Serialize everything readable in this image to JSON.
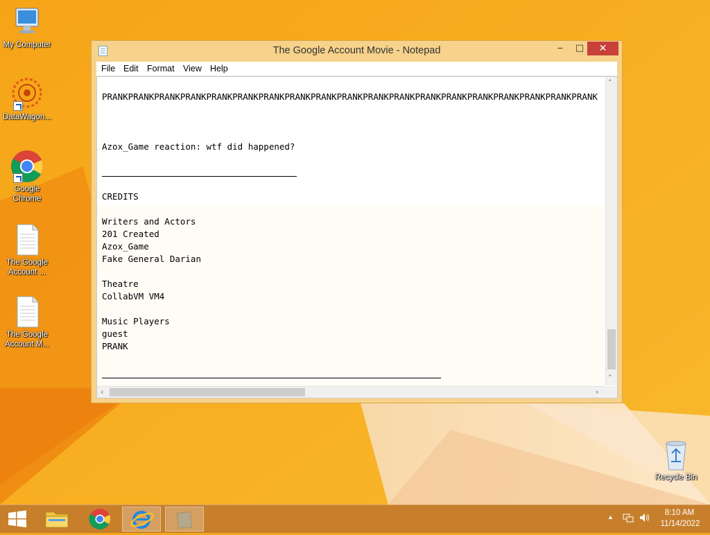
{
  "desktop": {
    "icons": [
      {
        "label": "My Computer",
        "icon": "computer-icon"
      },
      {
        "label": "DataWagon...",
        "icon": "datawagon-icon"
      },
      {
        "label": "Google Chrome",
        "icon": "chrome-icon"
      },
      {
        "label": "The Google Account ...",
        "icon": "text-file-icon"
      },
      {
        "label": "The Google Account M...",
        "icon": "text-file-icon"
      },
      {
        "label": "Recycle Bin",
        "icon": "recycle-bin-icon"
      }
    ],
    "colors": {
      "background": "#f4a81c",
      "accent_light": "#f7d28a"
    }
  },
  "window": {
    "title": "The Google Account Movie - Notepad",
    "controls": {
      "minimize": "‒",
      "maximize": "□",
      "close": "✕"
    },
    "menu": [
      "File",
      "Edit",
      "Format",
      "View",
      "Help"
    ],
    "content": {
      "prank_line": "PRANKPRANKPRANKPRANKPRANKPRANKPRANKPRANKPRANKPRANKPRANKPRANKPRANKPRANKPRANKPRANKPRANKPRANKPRANK",
      "reaction": "Azox_Game reaction: wtf did happened?",
      "credits": "CREDITS",
      "writers_heading": "Writers and Actors",
      "writers": [
        "201 Created",
        "Azox_Game",
        "Fake General Darian"
      ],
      "theatre_heading": "Theatre",
      "theatre": "CollabVM VM4",
      "music_heading": "Music Players",
      "music": [
        "guest",
        "PRANK"
      ]
    }
  },
  "taskbar": {
    "pinned": [
      {
        "name": "start-button",
        "icon": "windows-logo-icon"
      },
      {
        "name": "file-explorer",
        "icon": "folder-icon"
      },
      {
        "name": "google-chrome",
        "icon": "chrome-icon"
      },
      {
        "name": "internet-explorer",
        "icon": "ie-icon"
      },
      {
        "name": "notepad",
        "icon": "notepad-icon"
      }
    ],
    "tray": {
      "time": "8:10 AM",
      "date": "11/14/2022",
      "show_hidden": "▲"
    }
  }
}
